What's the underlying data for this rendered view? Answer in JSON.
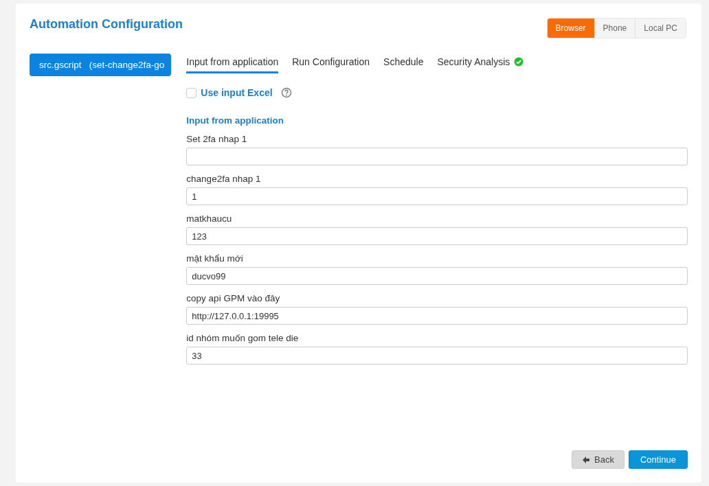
{
  "title": "Automation Configuration",
  "platforms": [
    {
      "label": "Browser",
      "selected": true
    },
    {
      "label": "Phone",
      "selected": false
    },
    {
      "label": "Local PC",
      "selected": false
    }
  ],
  "script_button": "src.gscript   (set-change2fa-go",
  "tabs": [
    {
      "label": "Input from application",
      "selected": true,
      "verified": false
    },
    {
      "label": "Run Configuration",
      "selected": false,
      "verified": false
    },
    {
      "label": "Schedule",
      "selected": false,
      "verified": false
    },
    {
      "label": "Security Analysis",
      "selected": false,
      "verified": true
    }
  ],
  "use_input_excel": {
    "label": "Use input Excel",
    "checked": false
  },
  "section_title": "Input from application",
  "fields": [
    {
      "label": "Set 2fa nhap 1"
    },
    {
      "label": "change2fa nhap 1",
      "value": "1"
    },
    {
      "label": "matkhaucu",
      "value": "123"
    },
    {
      "label": "mật khẩu mới",
      "value": "ducvo99"
    },
    {
      "label": "copy api GPM vào đây",
      "value": "http://127.0.0.1:19995"
    },
    {
      "label": "id nhóm muốn gom tele die",
      "value": "33"
    }
  ],
  "buttons": {
    "back": "Back",
    "continue": "Continue"
  }
}
